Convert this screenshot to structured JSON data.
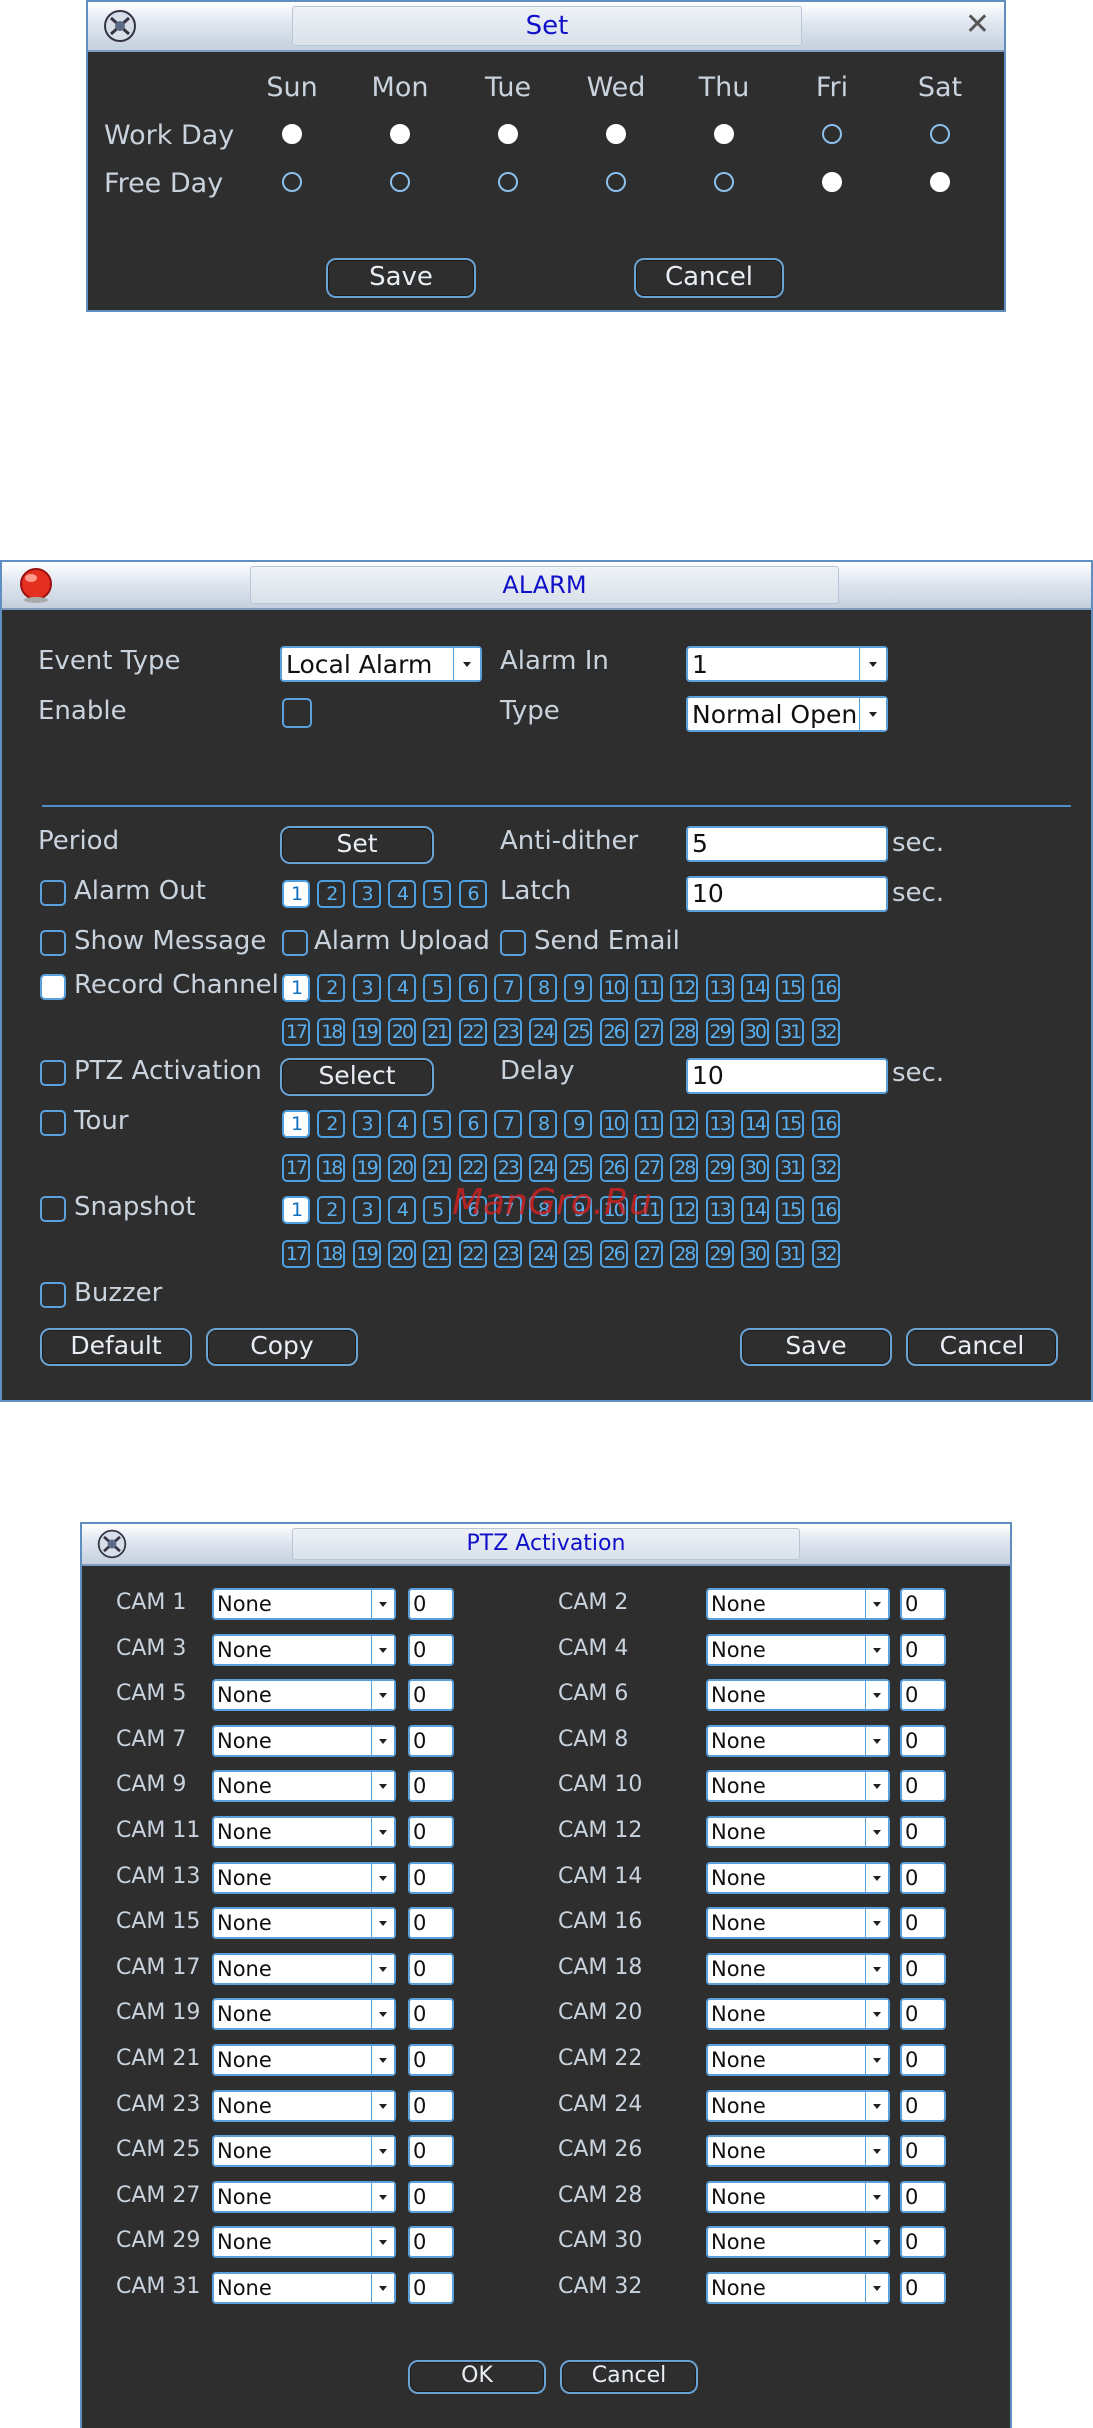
{
  "set_dialog": {
    "title": "Set",
    "days": [
      "Sun",
      "Mon",
      "Tue",
      "Wed",
      "Thu",
      "Fri",
      "Sat"
    ],
    "rows": [
      {
        "label": "Work Day",
        "checked": [
          true,
          true,
          true,
          true,
          true,
          false,
          false
        ]
      },
      {
        "label": "Free Day",
        "checked": [
          false,
          false,
          false,
          false,
          false,
          true,
          true
        ]
      }
    ],
    "save_label": "Save",
    "cancel_label": "Cancel",
    "close_glyph": "✕"
  },
  "alarm_dialog": {
    "title": "ALARM",
    "event_type_label": "Event Type",
    "event_type_value": "Local Alarm",
    "alarm_in_label": "Alarm In",
    "alarm_in_value": "1",
    "enable_label": "Enable",
    "enable_checked": false,
    "type_label": "Type",
    "type_value": "Normal Open",
    "period_label": "Period",
    "set_button": "Set",
    "anti_dither_label": "Anti-dither",
    "anti_dither_value": "5",
    "sec_label": "sec.",
    "alarm_out_label": "Alarm Out",
    "alarm_out_channels": [
      "1",
      "2",
      "3",
      "4",
      "5",
      "6"
    ],
    "latch_label": "Latch",
    "latch_value": "10",
    "show_message_label": "Show Message",
    "alarm_upload_label": "Alarm Upload",
    "send_email_label": "Send Email",
    "record_channel_label": "Record Channel",
    "channels_32": [
      "1",
      "2",
      "3",
      "4",
      "5",
      "6",
      "7",
      "8",
      "9",
      "10",
      "11",
      "12",
      "13",
      "14",
      "15",
      "16",
      "17",
      "18",
      "19",
      "20",
      "21",
      "22",
      "23",
      "24",
      "25",
      "26",
      "27",
      "28",
      "29",
      "30",
      "31",
      "32"
    ],
    "ptz_activation_label": "PTZ Activation",
    "select_button": "Select",
    "delay_label": "Delay",
    "delay_value": "10",
    "tour_label": "Tour",
    "snapshot_label": "Snapshot",
    "buzzer_label": "Buzzer",
    "default_button": "Default",
    "copy_button": "Copy",
    "save_button": "Save",
    "cancel_button": "Cancel",
    "watermark": "ManGro.Ru",
    "checks": {
      "alarm_out": false,
      "show_message": false,
      "alarm_upload": false,
      "send_email": false,
      "record_channel": true,
      "ptz": false,
      "tour": false,
      "snapshot": false,
      "buzzer": false
    }
  },
  "ptz_dialog": {
    "title": "PTZ Activation",
    "cams": [
      {
        "label": "CAM 1",
        "mode": "None",
        "value": "0"
      },
      {
        "label": "CAM 2",
        "mode": "None",
        "value": "0"
      },
      {
        "label": "CAM 3",
        "mode": "None",
        "value": "0"
      },
      {
        "label": "CAM 4",
        "mode": "None",
        "value": "0"
      },
      {
        "label": "CAM 5",
        "mode": "None",
        "value": "0"
      },
      {
        "label": "CAM 6",
        "mode": "None",
        "value": "0"
      },
      {
        "label": "CAM 7",
        "mode": "None",
        "value": "0"
      },
      {
        "label": "CAM 8",
        "mode": "None",
        "value": "0"
      },
      {
        "label": "CAM 9",
        "mode": "None",
        "value": "0"
      },
      {
        "label": "CAM 10",
        "mode": "None",
        "value": "0"
      },
      {
        "label": "CAM 11",
        "mode": "None",
        "value": "0"
      },
      {
        "label": "CAM 12",
        "mode": "None",
        "value": "0"
      },
      {
        "label": "CAM 13",
        "mode": "None",
        "value": "0"
      },
      {
        "label": "CAM 14",
        "mode": "None",
        "value": "0"
      },
      {
        "label": "CAM 15",
        "mode": "None",
        "value": "0"
      },
      {
        "label": "CAM 16",
        "mode": "None",
        "value": "0"
      },
      {
        "label": "CAM 17",
        "mode": "None",
        "value": "0"
      },
      {
        "label": "CAM 18",
        "mode": "None",
        "value": "0"
      },
      {
        "label": "CAM 19",
        "mode": "None",
        "value": "0"
      },
      {
        "label": "CAM 20",
        "mode": "None",
        "value": "0"
      },
      {
        "label": "CAM 21",
        "mode": "None",
        "value": "0"
      },
      {
        "label": "CAM 22",
        "mode": "None",
        "value": "0"
      },
      {
        "label": "CAM 23",
        "mode": "None",
        "value": "0"
      },
      {
        "label": "CAM 24",
        "mode": "None",
        "value": "0"
      },
      {
        "label": "CAM 25",
        "mode": "None",
        "value": "0"
      },
      {
        "label": "CAM 26",
        "mode": "None",
        "value": "0"
      },
      {
        "label": "CAM 27",
        "mode": "None",
        "value": "0"
      },
      {
        "label": "CAM 28",
        "mode": "None",
        "value": "0"
      },
      {
        "label": "CAM 29",
        "mode": "None",
        "value": "0"
      },
      {
        "label": "CAM 30",
        "mode": "None",
        "value": "0"
      },
      {
        "label": "CAM 31",
        "mode": "None",
        "value": "0"
      },
      {
        "label": "CAM 32",
        "mode": "None",
        "value": "0"
      }
    ],
    "ok_button": "OK",
    "cancel_button": "Cancel"
  }
}
